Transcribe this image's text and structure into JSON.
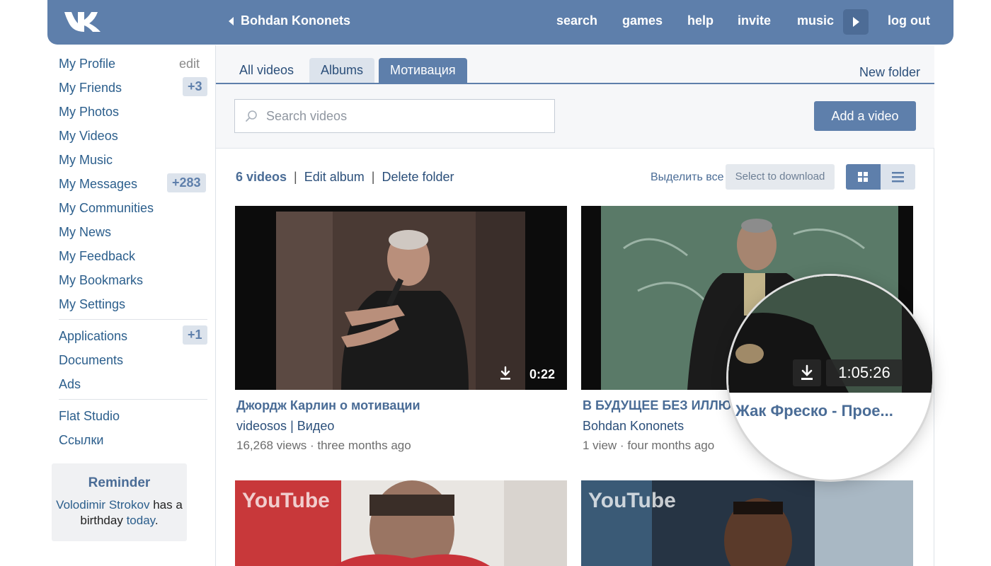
{
  "header": {
    "user_name": "Bohdan Kononets",
    "nav": [
      "search",
      "games",
      "help",
      "invite",
      "music"
    ],
    "logout": "log out"
  },
  "sidebar": {
    "items": [
      {
        "label": "My Profile"
      },
      {
        "label": "My Friends",
        "badge": "+3"
      },
      {
        "label": "My Photos"
      },
      {
        "label": "My Videos"
      },
      {
        "label": "My Music"
      },
      {
        "label": "My Messages",
        "badge": "+283"
      },
      {
        "label": "My Communities"
      },
      {
        "label": "My News"
      },
      {
        "label": "My Feedback"
      },
      {
        "label": "My Bookmarks"
      },
      {
        "label": "My Settings"
      }
    ],
    "edit_label": "edit",
    "apps": [
      {
        "label": "Applications",
        "badge": "+1"
      },
      {
        "label": "Documents"
      },
      {
        "label": "Ads"
      }
    ],
    "extra": [
      {
        "label": "Flat Studio"
      },
      {
        "label": "Ссылки"
      }
    ],
    "reminder": {
      "title": "Reminder",
      "person": "Volodimir Strokov",
      "text_1": "has",
      "text_2": "a birthday",
      "today": "today",
      "period": "."
    }
  },
  "tabs": [
    {
      "label": "All videos",
      "state": "plain"
    },
    {
      "label": "Albums",
      "state": "gray"
    },
    {
      "label": "Мотивация",
      "state": "active"
    }
  ],
  "new_folder": "New folder",
  "search": {
    "placeholder": "Search videos",
    "value": ""
  },
  "add_video": "Add a video",
  "toolbar": {
    "count": "6 videos",
    "separator": "|",
    "edit_album": "Edit album",
    "delete_folder": "Delete folder",
    "select_all": "Выделить все",
    "select_to_download": "Select to download"
  },
  "videos": [
    {
      "title": "Джордж Карлин о мотивации",
      "author": "videosos",
      "channel": "Видео",
      "views": "16,268 views",
      "dot": "·",
      "date": "three months ago",
      "duration": "0:22"
    },
    {
      "title": "В БУДУЩЕЕ БЕЗ ИЛЛЮ",
      "author": "Bohdan Kononets",
      "views": "1 view",
      "dot": "·",
      "date": "four months ago",
      "duration": "1:05:26"
    }
  ],
  "magnifier": {
    "duration": "1:05:26",
    "title": "Жак Фреско - Прое..."
  },
  "watermark": "YouTube",
  "colors": {
    "header_bg": "#5e7fab",
    "link": "#2b5e8c",
    "badge_bg": "#dce3ec",
    "tab_active": "#5e7fab"
  }
}
